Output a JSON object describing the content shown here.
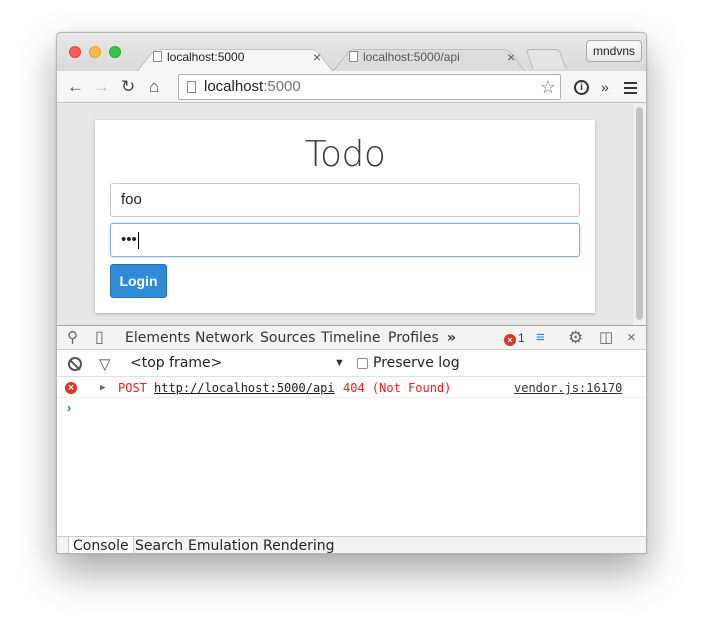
{
  "window": {
    "tabs": [
      {
        "title": "localhost:5000",
        "close": "×"
      },
      {
        "title": "localhost:5000/api",
        "close": "×"
      }
    ],
    "profile_name": "mndvns"
  },
  "toolbar": {
    "back": "←",
    "forward": "→",
    "reload": "↻",
    "home": "⌂",
    "url_host": "localhost",
    "url_port": ":5000",
    "star": "☆",
    "info": "i",
    "overflow": "»"
  },
  "page": {
    "title": "Todo",
    "username_value": "foo",
    "password_value": "•••",
    "login_label": "Login"
  },
  "devtools": {
    "tabs": [
      "Elements",
      "Network",
      "Sources",
      "Timeline",
      "Profiles"
    ],
    "more_tabs": "»",
    "error_count": "1",
    "close": "×",
    "frame_selector": "<top frame>",
    "preserve_log_label": "Preserve log",
    "console_message": {
      "method": "POST",
      "url": "http://localhost:5000/api",
      "status": "404 (Not Found)",
      "source": "vendor.js:16170"
    },
    "prompt": "›",
    "drawer_tabs": [
      "Console",
      "Search",
      "Emulation",
      "Rendering"
    ]
  },
  "colors": {
    "login_button": "#2f8ad8",
    "error_red": "#e0261b",
    "prompt_blue": "#2b7cd3"
  }
}
